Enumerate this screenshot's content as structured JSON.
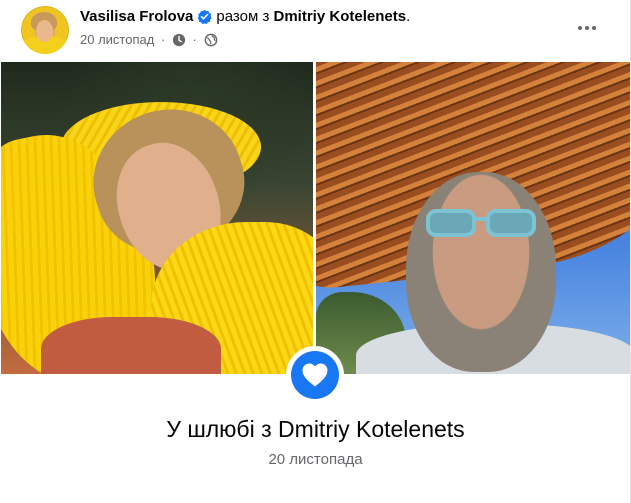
{
  "post": {
    "author": "Vasilisa Frolova",
    "with_word": "разом з",
    "tagged_person": "Dmitriy Kotelenets",
    "tagged_suffix": ".",
    "date": "20 листопад",
    "separator": "·",
    "audience_icon": "globe-icon",
    "clock_icon": "clock-icon",
    "more_icon": "more-options-icon"
  },
  "event": {
    "title": "У шлюбі з Dmitriy Kotelenets",
    "date": "20 листопада",
    "icon": "heart-icon"
  },
  "colors": {
    "accent": "#1877f2",
    "secondary_text": "#65676b",
    "primary_text": "#050505"
  }
}
